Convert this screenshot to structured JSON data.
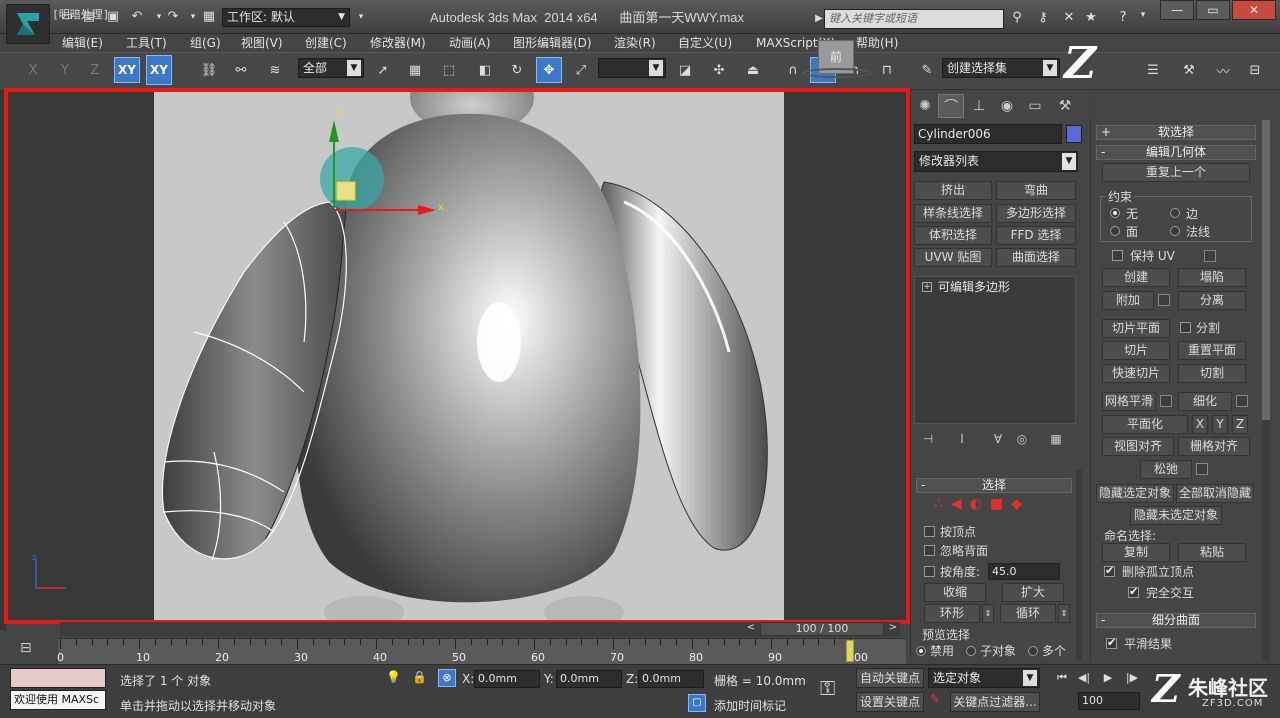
{
  "titlebar": {
    "workspace": "工作区: 默认",
    "title": "Autodesk 3ds Max  2014 x64      曲面第一天WWY.max",
    "search_placeholder": "键入关键字或短语"
  },
  "menus": [
    "编辑(E)",
    "工具(T)",
    "组(G)",
    "视图(V)",
    "创建(C)",
    "修改器(M)",
    "动画(A)",
    "图形编辑器(D)",
    "渲染(R)",
    "自定义(U)",
    "MAXScript(X)",
    "帮助(H)"
  ],
  "toolbar": {
    "axis_xy": "XY",
    "axis_xy2": "XY",
    "filter": "全部",
    "selection_set": "创建选择集"
  },
  "viewport": {
    "label": "[+][前][明暗处理]",
    "viewcube": "前",
    "gizmo_x": "x",
    "gizmo_y": "y"
  },
  "command_panel": {
    "object_name": "Cylinder006",
    "modifier_list": "修改器列表",
    "mod_buttons": [
      "挤出",
      "弯曲",
      "样条线选择",
      "多边形选择",
      "体积选择",
      "FFD 选择",
      "UVW 贴图",
      "曲面选择"
    ],
    "stack_item": "可编辑多边形",
    "selection": {
      "title": "选择",
      "by_vertex": "按顶点",
      "ignore_backfacing": "忽略背面",
      "by_angle": "按角度:",
      "angle_value": "45.0",
      "shrink": "收缩",
      "grow": "扩大",
      "ring": "环形",
      "loop": "循环",
      "preview_selection": "预览选择",
      "disabled": "禁用",
      "sub_object": "子对象",
      "multiple": "多个"
    }
  },
  "edit_geometry": {
    "soft_selection": "软选择",
    "title": "编辑几何体",
    "repeat_last": "重复上一个",
    "constraints": "约束",
    "none": "无",
    "edge": "边",
    "face": "面",
    "normal": "法线",
    "preserve_uv": "保持 UV",
    "create": "创建",
    "collapse": "塌陷",
    "attach": "附加",
    "detach": "分离",
    "slice_plane": "切片平面",
    "split": "分割",
    "slice": "切片",
    "reset_plane": "重置平面",
    "quickslice": "快速切片",
    "cut": "切割",
    "meshsmooth": "网格平滑",
    "tessellate": "细化",
    "make_planar": "平面化",
    "x": "X",
    "y": "Y",
    "z": "Z",
    "view_align": "视图对齐",
    "grid_align": "栅格对齐",
    "relax": "松弛",
    "hide_selected": "隐藏选定对象",
    "unhide_all": "全部取消隐藏",
    "hide_unselected": "隐藏未选定对象",
    "named_selections": "命名选择:",
    "copy": "复制",
    "paste": "粘贴",
    "delete_isolated": "删除孤立顶点",
    "full_interactivity": "完全交互",
    "subdivision_surface": "细分曲面",
    "smooth_result": "平滑结果"
  },
  "timeline": {
    "range": "100 / 100",
    "ticks": [
      "0",
      "10",
      "20",
      "30",
      "40",
      "50",
      "60",
      "70",
      "80",
      "90",
      "100"
    ],
    "current_frame": 100,
    "total_frames": 100
  },
  "statusbar": {
    "welcome": "欢迎使用 MAXSc",
    "selected": "选择了 1 个 对象",
    "prompt": "单击并拖动以选择并移动对象",
    "x_label": "X:",
    "x_value": "0.0mm",
    "y_label": "Y:",
    "y_value": "0.0mm",
    "z_label": "Z:",
    "z_value": "0.0mm",
    "grid": "栅格 = 10.0mm",
    "add_time_tag": "添加时间标记",
    "auto_key": "自动关键点",
    "set_key": "设置关键点",
    "selected_objects": "选定对象",
    "key_filters": "关键点过滤器...",
    "frame_value": "100"
  },
  "watermark": {
    "text": "朱峰社区",
    "url": "ZF3D.COM"
  }
}
